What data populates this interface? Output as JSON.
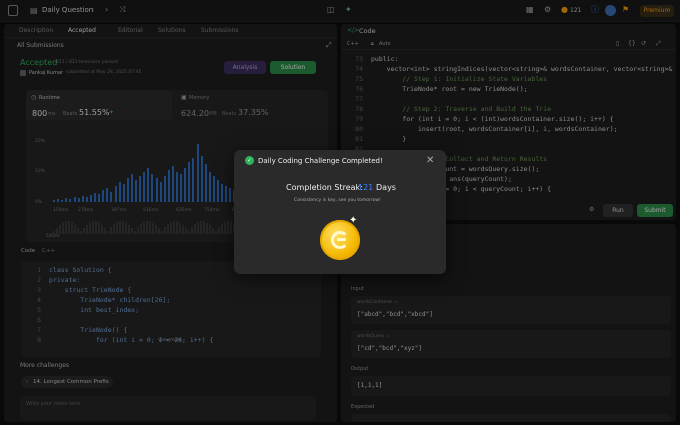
{
  "topbar": {
    "title": "Daily Question",
    "streak": "121",
    "premium": "Premium"
  },
  "left": {
    "tabs": [
      "Description",
      "Accepted",
      "Editorial",
      "Solutions",
      "Submissions"
    ],
    "back": "All Submissions",
    "status": "Accepted",
    "status_sub": "811 / 811 testcases passed",
    "user": "Pankaj Kumar",
    "submitted": "submitted at May 28, 2025 07:45",
    "analysis": "Analysis",
    "solution": "Solution",
    "runtime_label": "Runtime",
    "runtime_value": "800",
    "runtime_unit": "ms",
    "beats_label": "Beats",
    "beats_value": "51.55%",
    "memory_label": "Memory",
    "memory_value": "624.20",
    "memory_unit": "MB",
    "memory_beats_label": "Beats",
    "memory_beats": "37.35%",
    "y_labels": [
      "20%",
      "10%",
      "0%"
    ],
    "x_labels": [
      "159ms",
      "278ms",
      "397ms",
      "516ms",
      "635ms",
      "754ms",
      "873ms"
    ],
    "x_labels2": [
      "526ms",
      "4..."
    ],
    "code_label": "Code",
    "code_lang": "C++",
    "code_lines": [
      {
        "n": "1",
        "t": "class Solution {"
      },
      {
        "n": "2",
        "t": "private:"
      },
      {
        "n": "3",
        "t": "    struct TrieNode {"
      },
      {
        "n": "4",
        "t": "        TrieNode* children[26];"
      },
      {
        "n": "5",
        "t": "        int best_index;"
      },
      {
        "n": "6",
        "t": ""
      },
      {
        "n": "7",
        "t": "        TrieNode() {"
      },
      {
        "n": "8",
        "t": "            for (int i = 0; i < 26; i++) {"
      }
    ],
    "view_more": "View more",
    "more_challenges": "More challenges",
    "challenge": "14. Longest Common Prefix",
    "notes_placeholder": "Write your notes here"
  },
  "right": {
    "code_title": "Code",
    "lang": "C++",
    "auto": "Auto",
    "code_lines": [
      {
        "n": "73",
        "t": "public:"
      },
      {
        "n": "74",
        "t": "    vector<int> stringIndices(vector<string>& wordsContainer, vector<string>& wordsQuery) {"
      },
      {
        "n": "75",
        "t": "        // Step 1: Initialize State Variables"
      },
      {
        "n": "76",
        "t": "        TrieNode* root = new TrieNode();"
      },
      {
        "n": "77",
        "t": ""
      },
      {
        "n": "78",
        "t": "        // Step 2: Traverse and Build the Trie"
      },
      {
        "n": "79",
        "t": "        for (int i = 0; i < (int)wordsContainer.size(); i++) {"
      },
      {
        "n": "80",
        "t": "            insert(root, wordsContainer[i], i, wordsContainer);"
      },
      {
        "n": "81",
        "t": "        }"
      },
      {
        "n": "82",
        "t": ""
      },
      {
        "n": "83",
        "t": "        // Step 3: Collect and Return Results"
      },
      {
        "n": "84",
        "t": "        int queryCount = wordsQuery.size();"
      },
      {
        "n": "85",
        "t": "        vector<int> ans(queryCount);"
      },
      {
        "n": "86",
        "t": "        for (int i = 0; i < queryCount; i++) {"
      }
    ],
    "run": "Run",
    "submit": "Submit",
    "input_label": "Input",
    "param1": "wordsContainer =",
    "value1": "[\"abcd\",\"bcd\",\"xbcd\"]",
    "param2": "wordsQuery =",
    "value2": "[\"cd\",\"bcd\",\"xyz\"]",
    "output_label": "Output",
    "output": "[1,1,1]",
    "expected_label": "Expected"
  },
  "modal": {
    "title": "Daily Coding Challenge Completed!",
    "streak_label": "Completion Streak:",
    "streak_value": "121",
    "streak_unit": "Days",
    "message": "Consistency is key, see you tomorrow!"
  }
}
